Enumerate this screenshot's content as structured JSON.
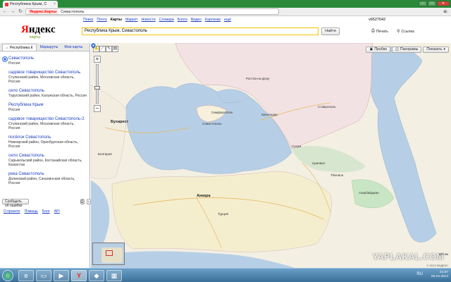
{
  "browser": {
    "tab_title": "Республика Крым, С",
    "tab_close": "×",
    "url_site": "Яндекс.Карты",
    "url_path": "Севастополь",
    "window_buttons": [
      "–",
      "□",
      "✕"
    ],
    "nav_icons": [
      "back-icon",
      "forward-icon",
      "reload-icon"
    ]
  },
  "yandex_nav": {
    "items": [
      "Поиск",
      "Почта",
      "Карты",
      "Маркет",
      "Новости",
      "Словари",
      "Блоги",
      "Видео",
      "Картинки",
      "ещё"
    ],
    "active": "Карты",
    "user_id": "v6527642"
  },
  "logo": {
    "text_red": "Я",
    "text_rest": "ндекс",
    "subtitle": "карты"
  },
  "search": {
    "value": "Республика Крым, Севастополь",
    "button": "Найти"
  },
  "header_buttons": {
    "print": "Печать",
    "link": "Ссылка"
  },
  "panel_tabs": [
    {
      "label": "Республика К",
      "icon": "home-icon"
    },
    {
      "label": "Маршруты"
    },
    {
      "label": "Мои карты"
    }
  ],
  "results": [
    {
      "title": "Севастополь",
      "sub": "Россия"
    },
    {
      "title": "садовое товарищество Севастополь",
      "sub": "Ступинский район, Московская область, Россия"
    },
    {
      "title": "село Севастополь",
      "sub": "Тарусовский район, Калужская область, Россия"
    },
    {
      "title": "Республика Крым",
      "sub": "Россия"
    },
    {
      "title": "садовое товарищество Севастополь-2",
      "sub": "Ступинский район, Московская область, Россия"
    },
    {
      "title": "посёлок Севастополь",
      "sub": "Новоорский район, Оренбургская область, Россия"
    },
    {
      "title": "село Севастополь",
      "sub": "Сарыкольский район, Костанайская область, Казахстан"
    },
    {
      "title": "река Севастополь",
      "sub": "Долинский район, Сахалинская область, Россия"
    }
  ],
  "report_button": "Сообщить об ошибке",
  "footer_links": [
    "О проекте",
    "Помощь",
    "Блог",
    "API"
  ],
  "map": {
    "buttons": {
      "traffic": "Пробки",
      "panorama": "Панорамы",
      "show": "Показать"
    },
    "labels": {
      "bucharest": "Бухарест",
      "simferopol": "Симферополь",
      "sevastopol_label": "Севастополь",
      "krasnodar": "Краснодар",
      "stavropol": "Ставрополь",
      "sukhum": "Сухум",
      "tbilisi": "Тбилиси",
      "tskhinval": "Цхинвал",
      "ankara": "Анкара",
      "turkey": "Турция",
      "azerbaijan": "Азербайджан",
      "rostov": "Ростов-на-Дону",
      "bulgaria": "Болгария"
    },
    "scale": "100 км",
    "copyright": "© 2013 ЯНДЕКС",
    "watermark": "YAPLAKAL.COM"
  },
  "taskbar": {
    "time": "21:57",
    "date": "06.04.2014",
    "lang": "RU"
  }
}
